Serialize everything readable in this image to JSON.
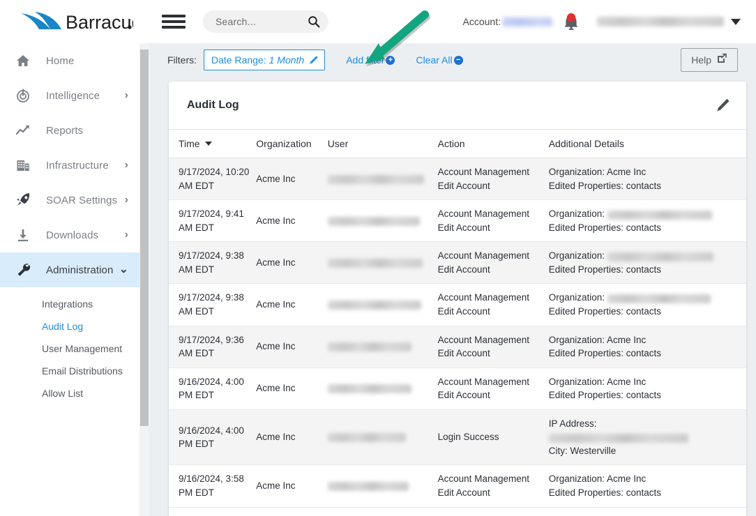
{
  "brand": {
    "name": "Barracuda."
  },
  "topbar": {
    "menu_icon": "hamburger-icon",
    "search": {
      "placeholder": "Search...",
      "value": "",
      "icon": "search-icon"
    },
    "account_label": "Account:",
    "account_value_redacted": true,
    "notifications_icon": "bell-icon",
    "notifications_has_alert": true,
    "user_name_redacted": true,
    "user_menu_icon": "chevron-down-icon"
  },
  "sidebar": {
    "items": [
      {
        "label": "Home",
        "icon": "home-icon",
        "expandable": false,
        "active": false
      },
      {
        "label": "Intelligence",
        "icon": "radar-icon",
        "expandable": true,
        "active": false
      },
      {
        "label": "Reports",
        "icon": "trending-up-icon",
        "expandable": false,
        "active": false
      },
      {
        "label": "Infrastructure",
        "icon": "building-icon",
        "expandable": true,
        "active": false
      },
      {
        "label": "SOAR Settings",
        "icon": "rocket-icon",
        "expandable": true,
        "active": false
      },
      {
        "label": "Downloads",
        "icon": "download-icon",
        "expandable": true,
        "active": false
      },
      {
        "label": "Administration",
        "icon": "wrench-icon",
        "expandable": true,
        "active": true
      }
    ],
    "subitems": [
      {
        "label": "Integrations",
        "selected": false
      },
      {
        "label": "Audit Log",
        "selected": true
      },
      {
        "label": "User Management",
        "selected": false
      },
      {
        "label": "Email Distributions",
        "selected": false
      },
      {
        "label": "Allow List",
        "selected": false
      }
    ]
  },
  "filters": {
    "label": "Filters:",
    "date_range": {
      "key": "Date Range:",
      "value": "1 Month",
      "edit_icon": "pencil-icon"
    },
    "add_filter": {
      "label": "Add filter",
      "badge": "+"
    },
    "clear_all": {
      "label": "Clear All",
      "badge": "−"
    },
    "help": {
      "label": "Help",
      "icon": "external-link-icon"
    }
  },
  "card": {
    "title": "Audit Log",
    "edit_icon": "pencil-icon"
  },
  "table": {
    "columns": [
      "Time",
      "Organization",
      "User",
      "Action",
      "Additional Details"
    ],
    "sorted_by": "Time",
    "sort_dir": "desc",
    "rows": [
      {
        "time": "9/17/2024, 10:20 AM EDT",
        "org": "Acme Inc",
        "user_redacted": true,
        "action": [
          "Account Management",
          "Edit Account"
        ],
        "details": [
          {
            "text": "Organization: Acme Inc"
          },
          {
            "text": "Edited Properties: contacts"
          }
        ]
      },
      {
        "time": "9/17/2024, 9:41 AM EDT",
        "org": "Acme Inc",
        "user_redacted": true,
        "action": [
          "Account Management",
          "Edit Account"
        ],
        "details": [
          {
            "text": "Organization:",
            "redacted": true
          },
          {
            "text": "Edited Properties: contacts"
          }
        ]
      },
      {
        "time": "9/17/2024, 9:38 AM EDT",
        "org": "Acme Inc",
        "user_redacted": true,
        "action": [
          "Account Management",
          "Edit Account"
        ],
        "details": [
          {
            "text": "Organization:",
            "redacted": true
          },
          {
            "text": "Edited Properties: contacts"
          }
        ]
      },
      {
        "time": "9/17/2024, 9:38 AM EDT",
        "org": "Acme Inc",
        "user_redacted": true,
        "action": [
          "Account Management",
          "Edit Account"
        ],
        "details": [
          {
            "text": "Organization:",
            "redacted": true
          },
          {
            "text": "Edited Properties: contacts"
          }
        ]
      },
      {
        "time": "9/17/2024, 9:36 AM EDT",
        "org": "Acme Inc",
        "user_redacted": true,
        "action": [
          "Account Management",
          "Edit Account"
        ],
        "details": [
          {
            "text": "Organization: Acme Inc"
          },
          {
            "text": "Edited Properties: contacts"
          }
        ]
      },
      {
        "time": "9/16/2024, 4:00 PM EDT",
        "org": "Acme Inc",
        "user_redacted": true,
        "action": [
          "Account Management",
          "Edit Account"
        ],
        "details": [
          {
            "text": "Organization: Acme Inc"
          },
          {
            "text": "Edited Properties: contacts"
          }
        ]
      },
      {
        "time": "9/16/2024, 4:00 PM EDT",
        "org": "Acme Inc",
        "user_redacted": true,
        "action": [
          "Login Success"
        ],
        "details": [
          {
            "text": "IP Address:"
          },
          {
            "text": "",
            "redacted": true
          },
          {
            "text": "City: Westerville"
          }
        ]
      },
      {
        "time": "9/16/2024, 3:58 PM EDT",
        "org": "Acme Inc",
        "user_redacted": true,
        "action": [
          "Account Management",
          "Edit Account"
        ],
        "details": [
          {
            "text": "Organization: Acme Inc"
          },
          {
            "text": "Edited Properties: contacts"
          }
        ]
      }
    ]
  },
  "annotation": {
    "arrow": {
      "color": "#12a57f",
      "points_to": "Add filter"
    }
  },
  "colors": {
    "brand_blue": "#1a86c8",
    "link_blue": "#1f8ce0",
    "active_nav_bg": "#d9ecfb",
    "page_bg": "#eceff1",
    "arrow_green": "#12a57f",
    "alert_red": "#e03030"
  }
}
